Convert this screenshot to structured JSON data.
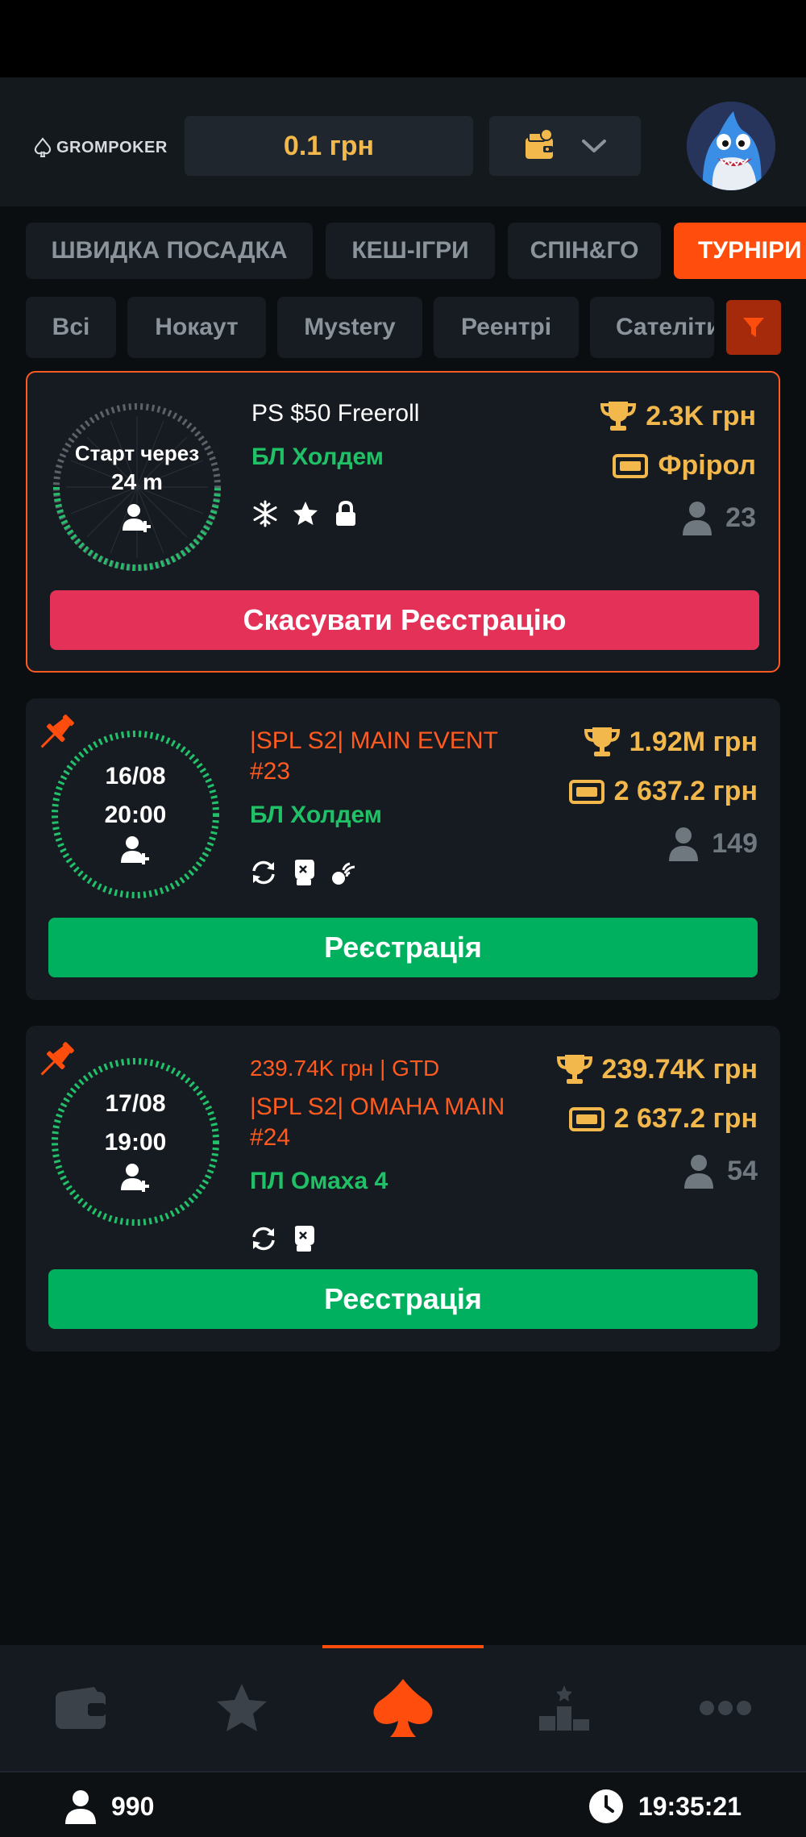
{
  "header": {
    "logo_text": "GROMPOKER",
    "balance": "0.1 грн"
  },
  "tabs": [
    {
      "label": "ШВИДКА ПОСАДКА",
      "active": false
    },
    {
      "label": "КЕШ-ІГРИ",
      "active": false
    },
    {
      "label": "СПІН&ГО",
      "active": false
    },
    {
      "label": "ТУРНІРИ",
      "active": true
    }
  ],
  "filters": [
    "Всі",
    "Нокаут",
    "Mystery",
    "Реентрі",
    "Сателіти"
  ],
  "tournaments": [
    {
      "ring_line1": "Старт через",
      "ring_line2": "24 m",
      "name": "PS $50 Freeroll",
      "game": "БЛ Холдем",
      "prize": "2.3K грн",
      "buyin": "Фрірол",
      "players": "23",
      "action": "Скасувати Реєстрацію",
      "icons": [
        "snowflake-icon",
        "star-icon",
        "lock-icon"
      ]
    },
    {
      "ring_line1": "16/08",
      "ring_line2": "20:00",
      "name": "|SPL S2| MAIN EVENT #23",
      "game": "БЛ Холдем",
      "prize": "1.92M грн",
      "buyin": "2 637.2 грн",
      "players": "149",
      "action": "Реєстрація",
      "icons": [
        "reentry-icon",
        "knockout-icon",
        "mystery-icon"
      ]
    },
    {
      "ring_line1": "17/08",
      "ring_line2": "19:00",
      "gtd": "239.74K грн  | GTD",
      "name": "|SPL S2| OMAHA MAIN #24",
      "game": "ПЛ Омаха 4",
      "prize": "239.74K грн",
      "buyin": "2 637.2 грн",
      "players": "54",
      "action": "Реєстрація",
      "icons": [
        "reentry-icon",
        "knockout-icon"
      ]
    }
  ],
  "footer": {
    "online": "990",
    "time": "19:35:21"
  },
  "colors": {
    "accent": "#ff4d0d",
    "gold": "#f2b84b",
    "green": "#01b05e",
    "red": "#e33158"
  }
}
